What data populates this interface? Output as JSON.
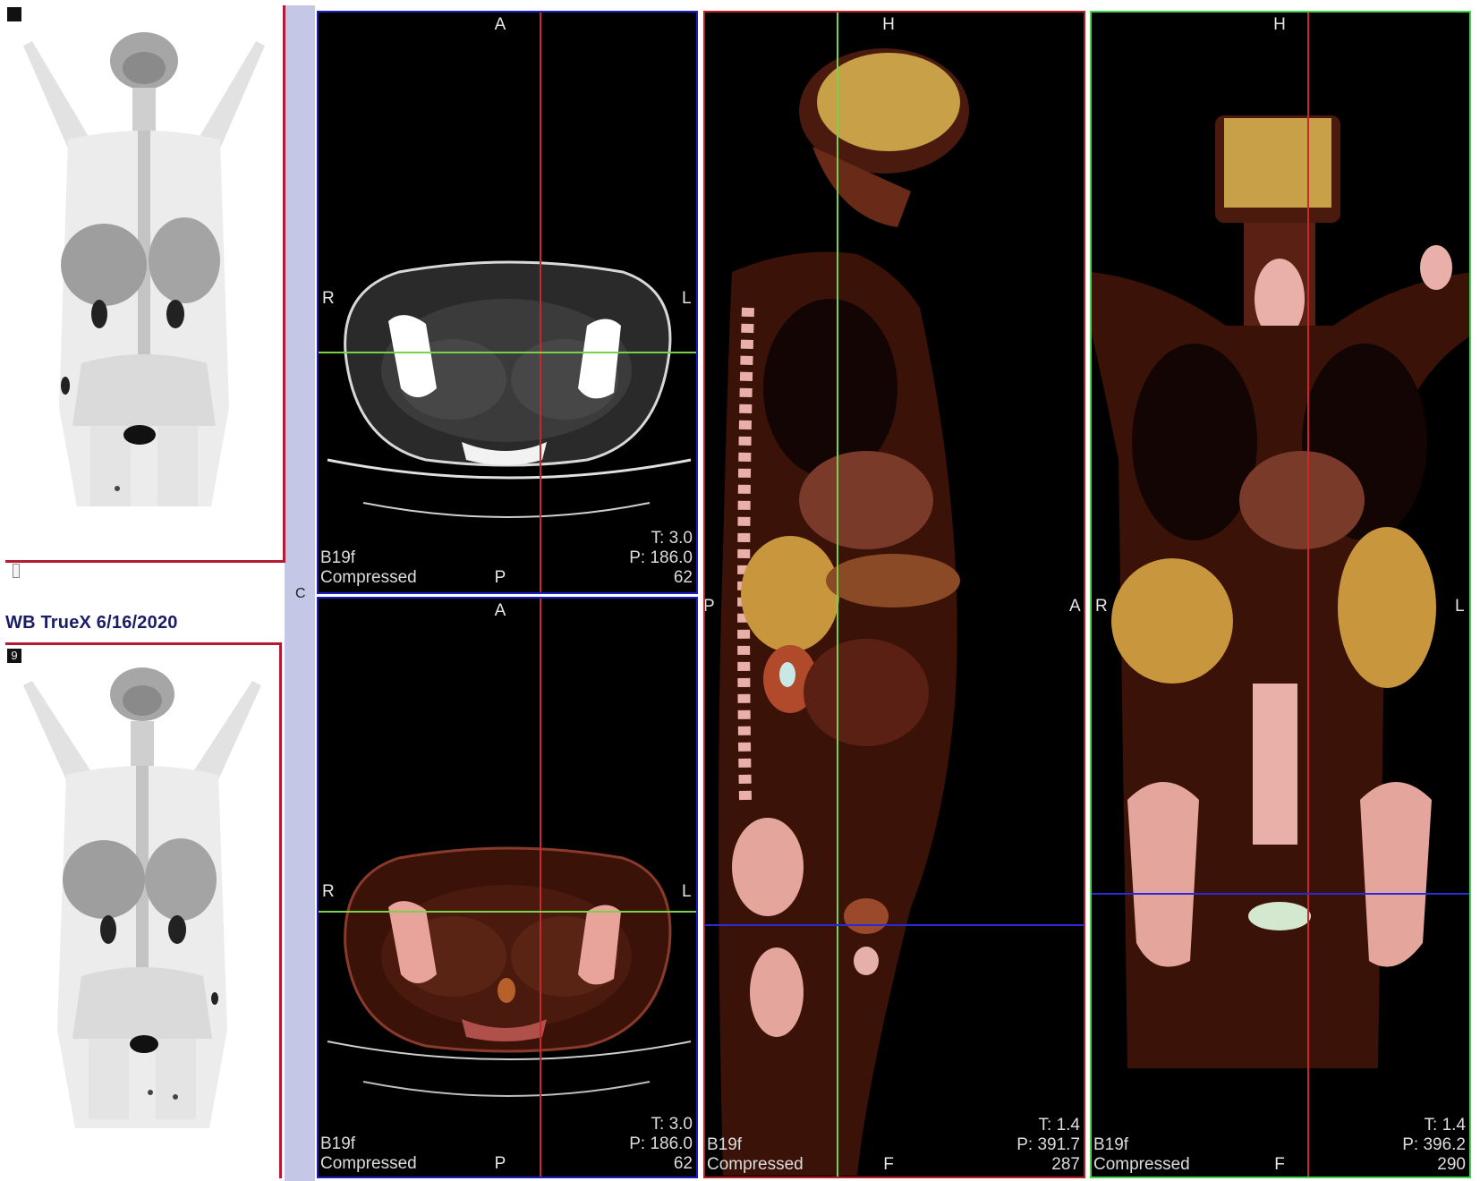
{
  "mip_panel": {
    "top_index": "",
    "bottom_index": "9",
    "series_label": "WB TrueX 6/16/2020",
    "side_marker": "C"
  },
  "viewports": {
    "axial_ct": {
      "orient_top": "A",
      "orient_left": "R",
      "orient_right": "L",
      "orient_bottom": "P",
      "recon": "B19f",
      "compression": "Compressed",
      "thickness": "T: 3.0",
      "position": "P: 186.0",
      "slice": "62"
    },
    "axial_fused": {
      "orient_top": "A",
      "orient_left": "R",
      "orient_right": "L",
      "orient_bottom": "P",
      "recon": "B19f",
      "compression": "Compressed",
      "thickness": "T: 3.0",
      "position": "P: 186.0",
      "slice": "62"
    },
    "sagittal_fused": {
      "orient_top": "H",
      "orient_left": "P",
      "orient_right": "A",
      "orient_bottom": "F",
      "recon": "B19f",
      "compression": "Compressed",
      "thickness": "T: 1.4",
      "position": "P: 391.7",
      "slice": "287"
    },
    "coronal_fused": {
      "orient_top": "H",
      "orient_left": "R",
      "orient_right": "L",
      "orient_bottom": "F",
      "recon": "B19f",
      "compression": "Compressed",
      "thickness": "T: 1.4",
      "position": "P: 396.2",
      "slice": "290"
    }
  },
  "colors": {
    "axial_border": "#1d1ec2",
    "sagittal_border": "#b91e24",
    "coronal_border": "#3fd24a",
    "crosshair_red": "#c8282a",
    "crosshair_green": "#7ad24a",
    "crosshair_blue": "#2a2ad8"
  }
}
